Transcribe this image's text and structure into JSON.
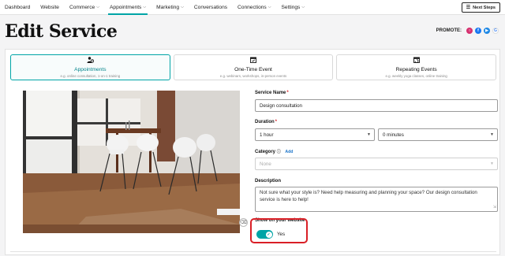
{
  "nav": {
    "items": [
      {
        "label": "Dashboard",
        "dropdown": false,
        "active": false
      },
      {
        "label": "Website",
        "dropdown": false,
        "active": false
      },
      {
        "label": "Commerce",
        "dropdown": true,
        "active": false
      },
      {
        "label": "Appointments",
        "dropdown": true,
        "active": true
      },
      {
        "label": "Marketing",
        "dropdown": true,
        "active": false
      },
      {
        "label": "Conversations",
        "dropdown": false,
        "active": false
      },
      {
        "label": "Connections",
        "dropdown": true,
        "active": false
      },
      {
        "label": "Settings",
        "dropdown": true,
        "active": false
      }
    ],
    "next_steps": "Next Steps"
  },
  "page": {
    "title": "Edit Service",
    "promote_label": "PROMOTE:",
    "promote_icons": [
      "instagram-icon",
      "facebook-icon",
      "youtube-icon",
      "google-icon"
    ]
  },
  "tabs": [
    {
      "label": "Appointments",
      "sub": "e.g. online consultation, 1-on-1 training",
      "icon": "people-icon",
      "active": true
    },
    {
      "label": "One-Time Event",
      "sub": "e.g. webinars, workshops, in-person events",
      "icon": "calendar-icon",
      "active": false
    },
    {
      "label": "Repeating Events",
      "sub": "e.g. weekly yoga classes, online training",
      "icon": "repeat-calendar-icon",
      "active": false
    }
  ],
  "form": {
    "service_name_label": "Service Name",
    "service_name_value": "Design consultation",
    "duration_label": "Duration",
    "duration_hours": "1 hour",
    "duration_minutes": "0 minutes",
    "category_label": "Category",
    "category_add": "Add",
    "category_value": "None",
    "description_label": "Description",
    "description_value": "Not sure what your style is? Need help measuring and planning your space? Our design consultation service is here to help!",
    "show_label": "Show on your website",
    "show_value": "Yes",
    "show_enabled": true
  },
  "colors": {
    "accent": "#00a4a6",
    "highlight": "#d91f26"
  }
}
